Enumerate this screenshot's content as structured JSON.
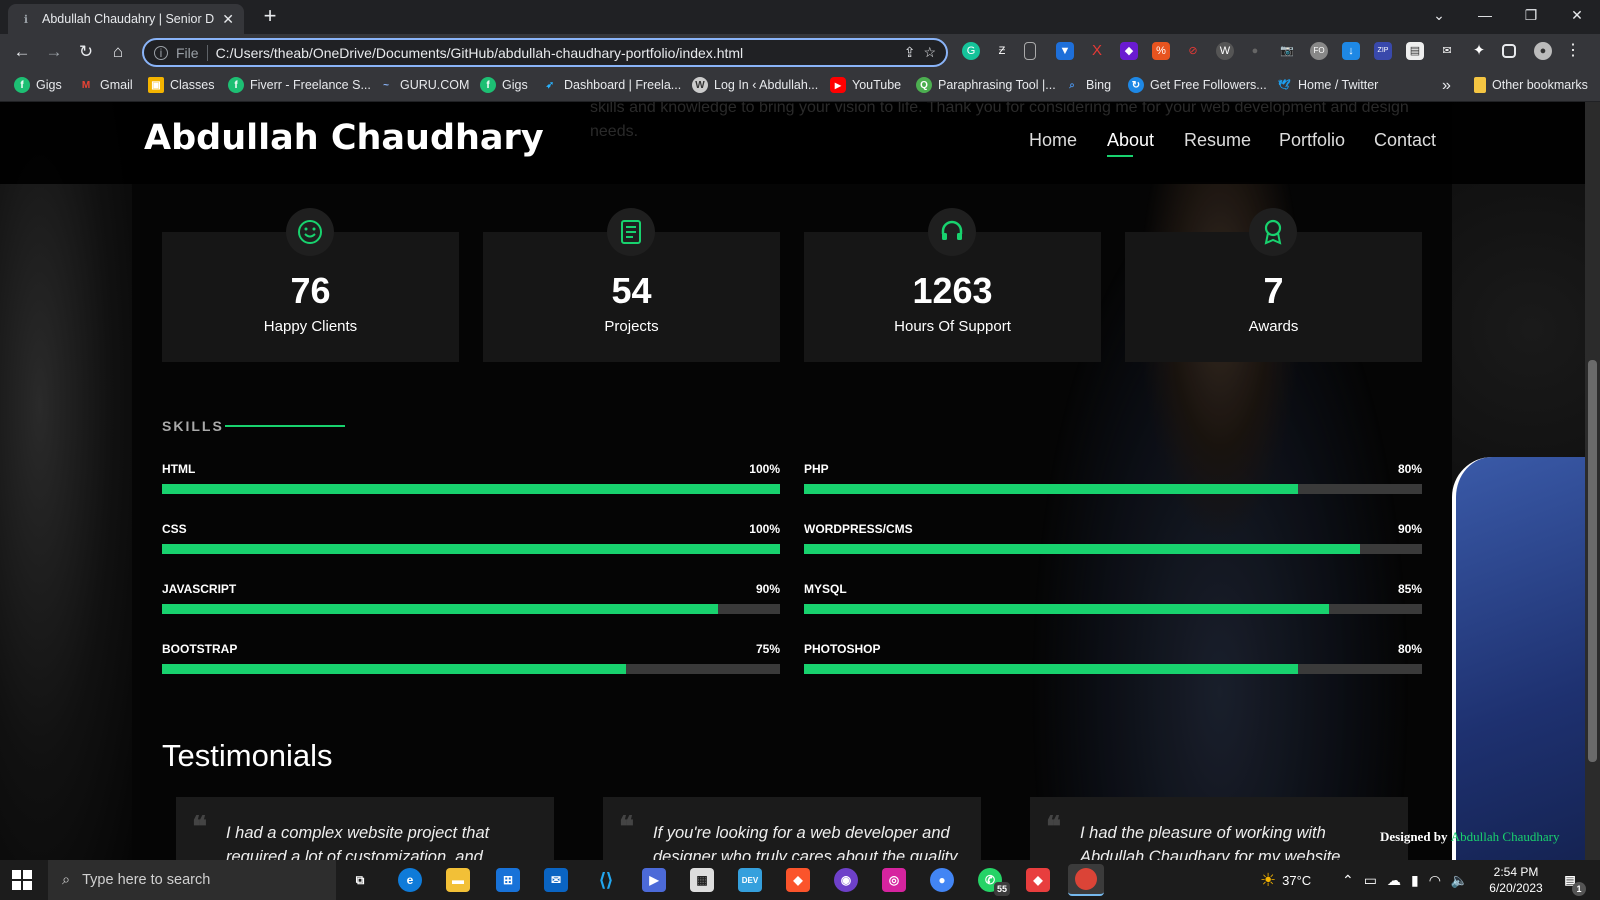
{
  "browser": {
    "tab_title": "Abdullah Chaudahry | Senior Dev",
    "url_scheme": "File",
    "url": "C:/Users/theab/OneDrive/Documents/GitHub/abdullah-chaudhary-portfolio/index.html",
    "bookmarks": [
      {
        "label": "Gigs",
        "icon": "fiverr-icon"
      },
      {
        "label": "Gmail",
        "icon": "gmail-icon"
      },
      {
        "label": "Classes",
        "icon": "classroom-icon"
      },
      {
        "label": "Fiverr - Freelance S...",
        "icon": "fiverr-icon"
      },
      {
        "label": "GURU.COM",
        "icon": "guru-icon"
      },
      {
        "label": "Gigs",
        "icon": "fiverr-icon"
      },
      {
        "label": "Dashboard | Freela...",
        "icon": "freelancer-icon"
      },
      {
        "label": "Log In ‹ Abdullah...",
        "icon": "wordpress-icon"
      },
      {
        "label": "YouTube",
        "icon": "youtube-icon"
      },
      {
        "label": "Paraphrasing Tool |...",
        "icon": "quillbot-icon"
      },
      {
        "label": "Bing",
        "icon": "bing-icon"
      },
      {
        "label": "Get Free Followers...",
        "icon": "followers-icon"
      },
      {
        "label": "Home / Twitter",
        "icon": "twitter-icon"
      }
    ],
    "more_bookmarks": "»",
    "other_bookmarks": "Other bookmarks"
  },
  "site": {
    "logo": "Abdullah Chaudhary",
    "nav": [
      "Home",
      "About",
      "Resume",
      "Portfolio",
      "Contact"
    ],
    "active_nav": "About",
    "ghost_text": "skills and knowledge to bring your vision to life. Thank you for considering me for your web development and design needs.",
    "stats": [
      {
        "value": "76",
        "label": "Happy Clients",
        "icon": "smiley-icon"
      },
      {
        "value": "54",
        "label": "Projects",
        "icon": "journal-icon"
      },
      {
        "value": "1263",
        "label": "Hours Of Support",
        "icon": "headset-icon"
      },
      {
        "value": "7",
        "label": "Awards",
        "icon": "award-icon"
      }
    ],
    "skills_title": "SKILLS",
    "skills": [
      {
        "name": "HTML",
        "percent_label": "100%",
        "value": 100
      },
      {
        "name": "PHP",
        "percent_label": "80%",
        "value": 80
      },
      {
        "name": "CSS",
        "percent_label": "100%",
        "value": 100
      },
      {
        "name": "WORDPRESS/CMS",
        "percent_label": "90%",
        "value": 90
      },
      {
        "name": "JAVASCRIPT",
        "percent_label": "90%",
        "value": 90
      },
      {
        "name": "MYSQL",
        "percent_label": "85%",
        "value": 85
      },
      {
        "name": "BOOTSTRAP",
        "percent_label": "75%",
        "value": 75
      },
      {
        "name": "PHOTOSHOP",
        "percent_label": "80%",
        "value": 80
      }
    ],
    "testimonials_title": "Testimonials",
    "testimonials": [
      {
        "text": "I had a complex website project that required a lot of customization, and"
      },
      {
        "text": "If you're looking for a web developer and designer who truly cares about the quality of"
      },
      {
        "text": "I had the pleasure of working with Abdullah Chaudhary for my website redesign"
      }
    ],
    "credit_prefix": "Designed by",
    "credit_name": "Abdullah Chaudhary",
    "accent": "#18d26e"
  },
  "taskbar": {
    "search_placeholder": "Type here to search",
    "weather": "37°C",
    "time": "2:54 PM",
    "date": "6/20/2023",
    "whatsapp_badge": "55",
    "notification_badge": "1"
  }
}
